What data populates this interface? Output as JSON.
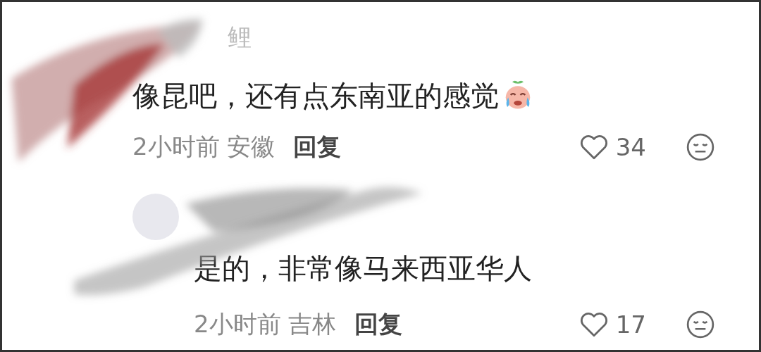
{
  "comments": [
    {
      "username": "鲤",
      "text": "像昆吧，还有点东南亚的感觉",
      "time": "2小时前",
      "location": "安徽",
      "reply_label": "回复",
      "likes": "34",
      "children": [
        {
          "text": "是的，非常像马来西亚华人",
          "time": "2小时前",
          "location": "吉林",
          "reply_label": "回复",
          "likes": "17"
        }
      ]
    }
  ]
}
